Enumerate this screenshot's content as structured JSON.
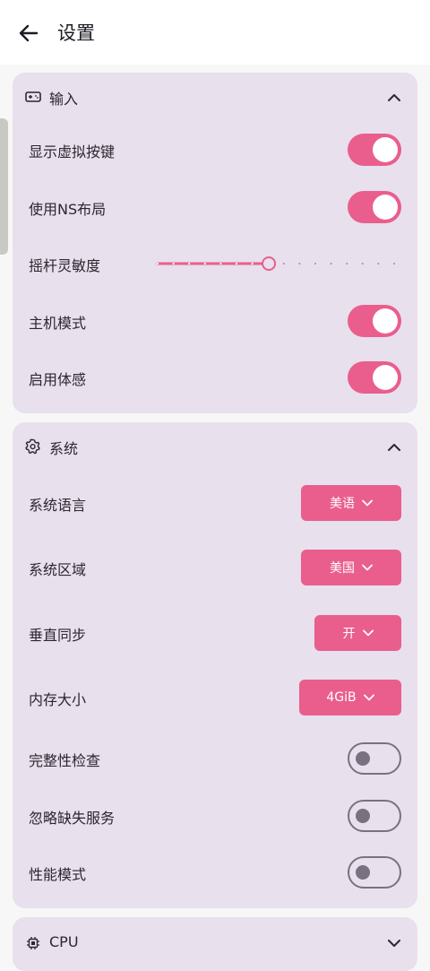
{
  "appbar": {
    "title": "设置"
  },
  "sections": {
    "input": {
      "title": "输入",
      "rows": [
        {
          "label": "显示虚拟按键",
          "on": true
        },
        {
          "label": "使用NS布局",
          "on": true
        },
        {
          "label": "摇杆灵敏度"
        },
        {
          "label": "主机模式",
          "on": true
        },
        {
          "label": "启用体感",
          "on": true
        }
      ],
      "slider": {
        "steps": 15,
        "value_fraction": 0.47
      }
    },
    "system": {
      "title": "系统",
      "rows": [
        {
          "label": "系统语言",
          "value": "美语"
        },
        {
          "label": "系统区域",
          "value": "美国"
        },
        {
          "label": "垂直同步",
          "value": "开"
        },
        {
          "label": "内存大小",
          "value": "4GiB"
        },
        {
          "label": "完整性检查",
          "on": false
        },
        {
          "label": "忽略缺失服务",
          "on": false
        },
        {
          "label": "性能模式",
          "on": false
        }
      ]
    },
    "cpu": {
      "title": "CPU"
    }
  },
  "icons": {
    "back": "arrow-left-icon",
    "input": "gamepad-icon",
    "system": "gear-icon",
    "cpu": "chip-icon",
    "collapse": "chevron-up-icon",
    "expand": "chevron-down-icon"
  },
  "colors": {
    "accent": "#e95e8d",
    "card": "#e8e0ec",
    "switch_off": "#7a7180"
  }
}
